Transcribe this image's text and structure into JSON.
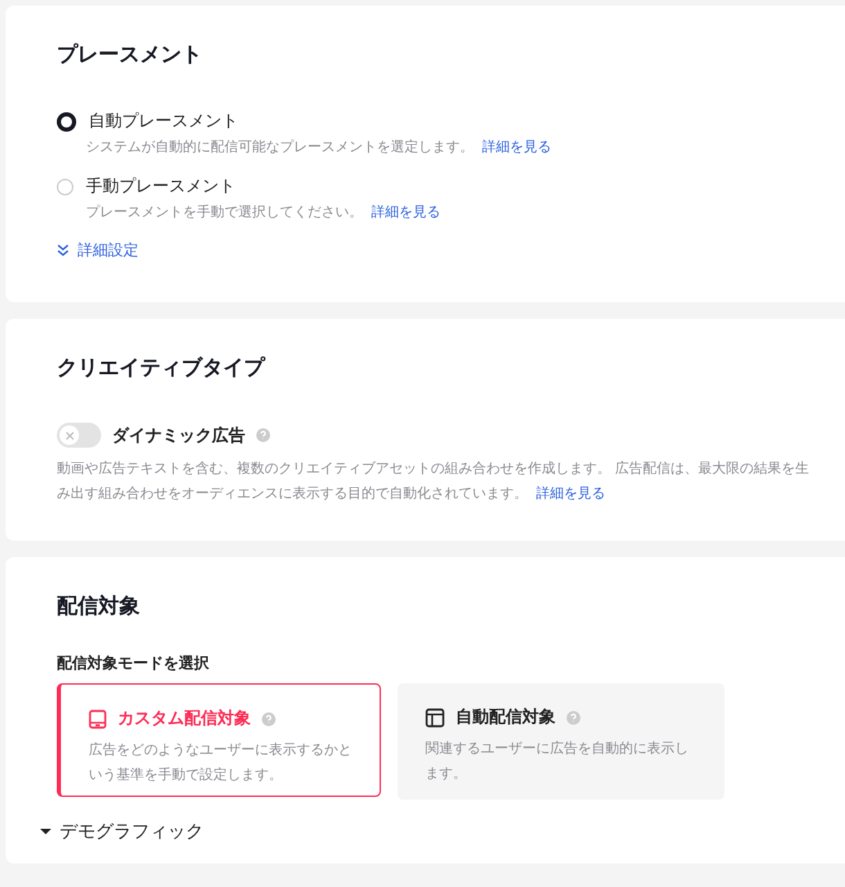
{
  "placement": {
    "title": "プレースメント",
    "options": [
      {
        "label": "自動プレースメント",
        "description": "システムが自動的に配信可能なプレースメントを選定します。",
        "link": "詳細を見る",
        "selected": true
      },
      {
        "label": "手動プレースメント",
        "description": "プレースメントを手動で選択してください。",
        "link": "詳細を見る",
        "selected": false
      }
    ],
    "advanced": {
      "label": "詳細設定",
      "expanded": false
    }
  },
  "creative_type": {
    "title": "クリエイティブタイプ",
    "toggle": {
      "label": "ダイナミック広告",
      "on": false
    },
    "description": "動画や広告テキストを含む、複数のクリエイティブアセットの組み合わせを作成します。 広告配信は、最大限の結果を生み出す組み合わせをオーディエンスに表示する目的で自動化されています。",
    "link": "詳細を見る"
  },
  "audience": {
    "title": "配信対象",
    "mode_label": "配信対象モードを選択",
    "modes": [
      {
        "kind": "custom",
        "title": "カスタム配信対象",
        "description": "広告をどのようなユーザーに表示するかという基準を手動で設定します。",
        "selected": true
      },
      {
        "kind": "auto",
        "title": "自動配信対象",
        "description": "関連するユーザーに広告を自動的に表示します。",
        "selected": false
      }
    ],
    "section": {
      "label": "デモグラフィック",
      "expanded": true
    }
  }
}
